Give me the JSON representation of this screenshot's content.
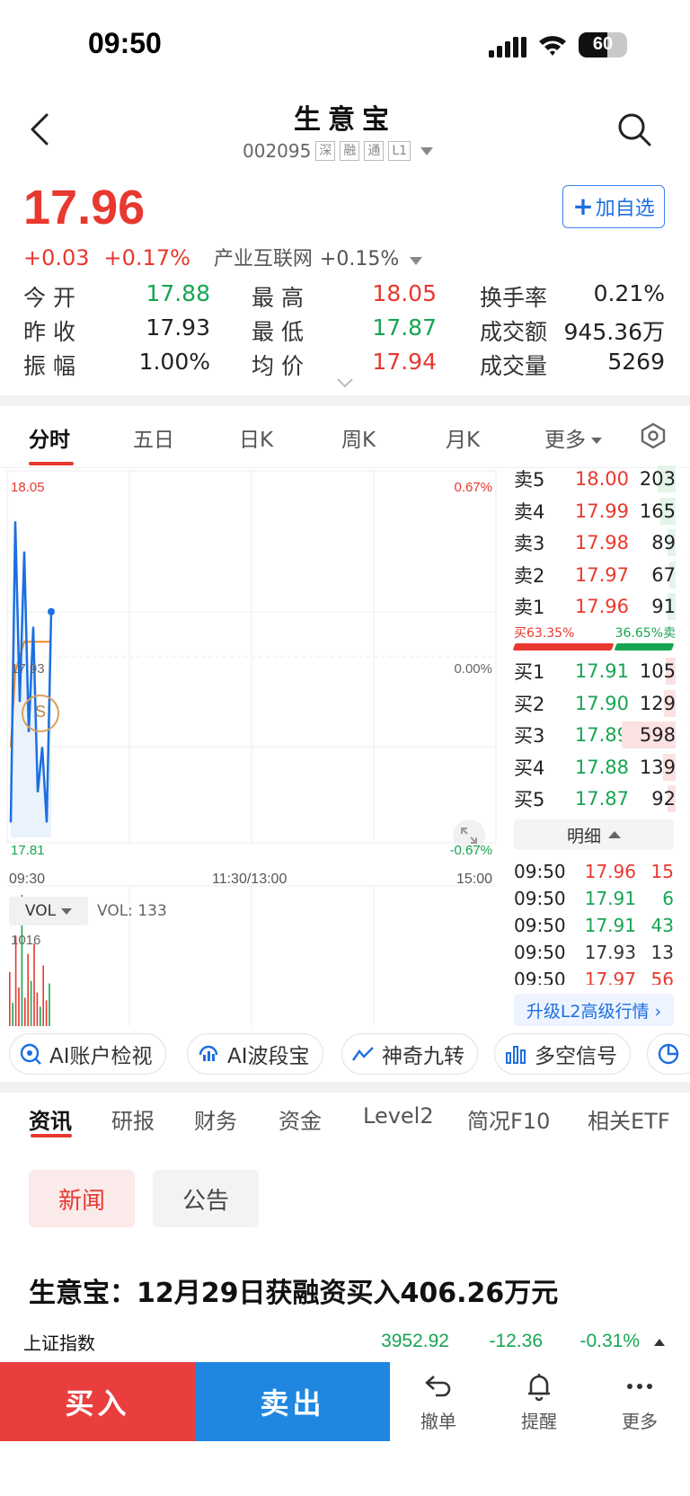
{
  "status": {
    "time": "09:50",
    "battery": "60"
  },
  "header": {
    "title": "生意宝",
    "code": "002095",
    "tags": [
      "深",
      "融",
      "通",
      "L1"
    ]
  },
  "quote": {
    "price": "17.96",
    "change": "+0.03",
    "change_pct": "+0.17%",
    "industry": "产业互联网",
    "industry_pct": "+0.15%",
    "add_watch": "加自选",
    "open_label": "今 开",
    "open": "17.88",
    "prev_label": "昨 收",
    "prev": "17.93",
    "amp_label": "振 幅",
    "amp": "1.00%",
    "high_label": "最 高",
    "high": "18.05",
    "low_label": "最 低",
    "low": "17.87",
    "avg_label": "均 价",
    "avg": "17.94",
    "turnover_label": "换手率",
    "turnover": "0.21%",
    "amount_label": "成交额",
    "amount": "945.36万",
    "volume_label": "成交量",
    "volume": "5269"
  },
  "chart_tabs": [
    "分时",
    "五日",
    "日K",
    "周K",
    "月K",
    "更多"
  ],
  "chart": {
    "y_top": "18.05",
    "y_mid": "17.93",
    "y_bottom": "17.81",
    "pct_top": "0.67%",
    "pct_mid": "0.00%",
    "pct_bottom": "-0.67%",
    "x_start": "09:30",
    "x_mid": "11:30/13:00",
    "x_end": "15:00",
    "marker": "S",
    "vol_select": "VOL",
    "vol_label": "VOL: 133",
    "vol_max": "1016"
  },
  "chart_data": {
    "type": "line",
    "ylim": [
      17.81,
      18.05
    ],
    "series": [
      {
        "values": [
          17.82,
          18.02,
          17.9,
          18.0,
          17.88,
          17.95,
          17.84,
          17.87,
          17.82,
          17.96
        ]
      },
      {
        "values": [
          17.87,
          17.92,
          17.93,
          17.94,
          17.94,
          17.94,
          17.94,
          17.94,
          17.94,
          17.94
        ]
      }
    ],
    "volumes": [
      420,
      180,
      700,
      300,
      1016,
      220,
      560,
      350,
      640,
      260,
      150,
      470,
      200,
      330
    ]
  },
  "orderbook": {
    "sell": [
      {
        "label": "卖5",
        "price": "18.00",
        "vol": "203",
        "ratio": 0.34
      },
      {
        "label": "卖4",
        "price": "17.99",
        "vol": "165",
        "ratio": 0.28
      },
      {
        "label": "卖3",
        "price": "17.98",
        "vol": "89",
        "ratio": 0.15
      },
      {
        "label": "卖2",
        "price": "17.97",
        "vol": "67",
        "ratio": 0.11
      },
      {
        "label": "卖1",
        "price": "17.96",
        "vol": "91",
        "ratio": 0.15
      }
    ],
    "buy_ratio_label": "买63.35%",
    "sell_ratio_label": "36.65%卖",
    "buy_ratio": 63.35,
    "buy": [
      {
        "label": "买1",
        "price": "17.91",
        "vol": "105",
        "ratio": 0.18
      },
      {
        "label": "买2",
        "price": "17.90",
        "vol": "129",
        "ratio": 0.22
      },
      {
        "label": "买3",
        "price": "17.89",
        "vol": "598",
        "ratio": 1.0
      },
      {
        "label": "买4",
        "price": "17.88",
        "vol": "139",
        "ratio": 0.23
      },
      {
        "label": "买5",
        "price": "17.87",
        "vol": "92",
        "ratio": 0.15
      }
    ],
    "detail_label": "明细",
    "ticks": [
      {
        "time": "09:50",
        "price": "17.96",
        "vol": "15",
        "dir": "up"
      },
      {
        "time": "09:50",
        "price": "17.91",
        "vol": "6",
        "dir": "down"
      },
      {
        "time": "09:50",
        "price": "17.91",
        "vol": "43",
        "dir": "down"
      },
      {
        "time": "09:50",
        "price": "17.93",
        "vol": "13",
        "dir": "flat"
      },
      {
        "time": "09:50",
        "price": "17.97",
        "vol": "56",
        "dir": "up"
      }
    ],
    "upgrade": "升级L2高级行情 ›"
  },
  "tools": [
    "AI账户检视",
    "AI波段宝",
    "神奇九转",
    "多空信号"
  ],
  "news_tabs": [
    "资讯",
    "研报",
    "财务",
    "资金",
    "Level2",
    "简况F10",
    "相关ETF"
  ],
  "chips": [
    "新闻",
    "公告"
  ],
  "headline": "生意宝：12月29日获融资买入406.26万元",
  "index": {
    "name": "上证指数",
    "value": "3952.92",
    "change": "-12.36",
    "pct": "-0.31%"
  },
  "bottom": {
    "buy": "买入",
    "sell": "卖出",
    "cancel": "撤单",
    "alert": "提醒",
    "more": "更多"
  },
  "colors": {
    "up": "#e8382f",
    "down": "#17a552",
    "accent": "#1d6fe0"
  }
}
